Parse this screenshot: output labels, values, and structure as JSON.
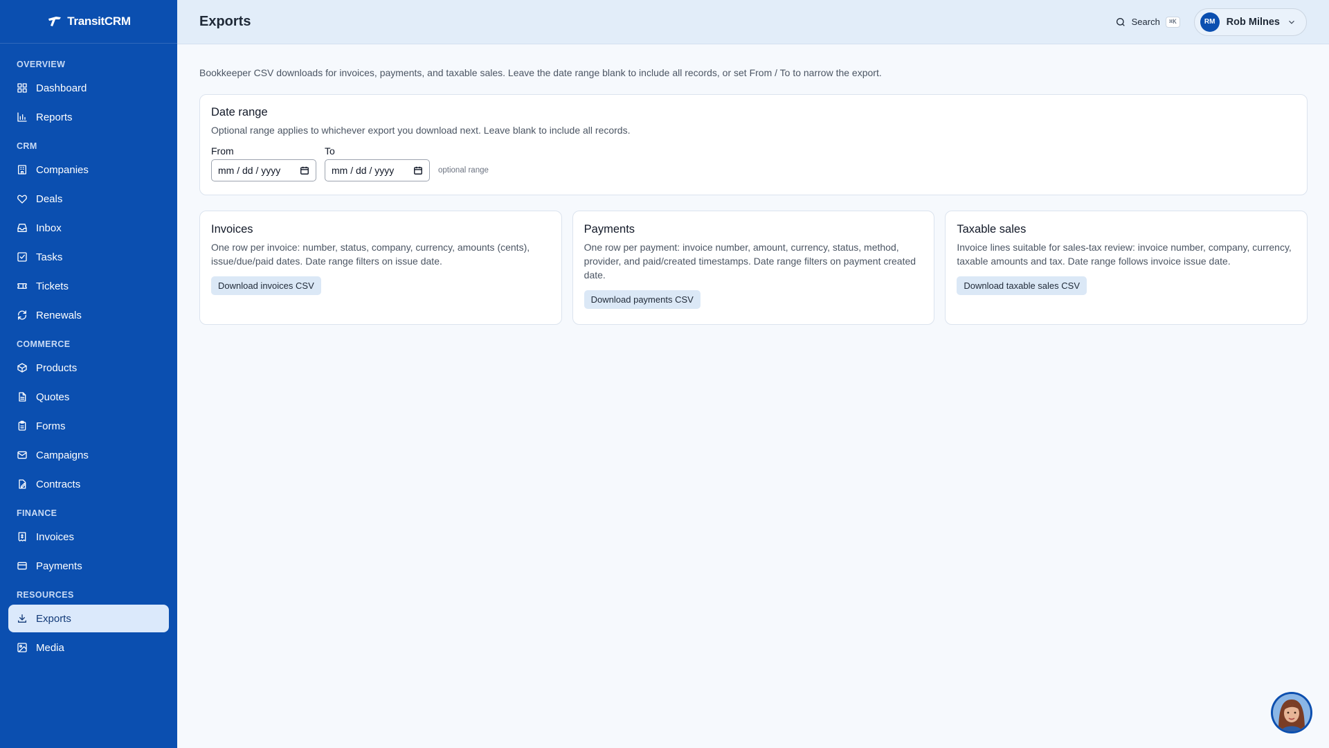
{
  "brand": {
    "name": "TransitCRM"
  },
  "sidebar": {
    "sections": [
      {
        "label": "OVERVIEW",
        "items": [
          {
            "label": "Dashboard",
            "icon": "dashboard-icon"
          },
          {
            "label": "Reports",
            "icon": "bar-chart-icon"
          }
        ]
      },
      {
        "label": "CRM",
        "items": [
          {
            "label": "Companies",
            "icon": "building-icon"
          },
          {
            "label": "Deals",
            "icon": "handshake-icon"
          },
          {
            "label": "Inbox",
            "icon": "inbox-icon"
          },
          {
            "label": "Tasks",
            "icon": "checkbox-icon"
          },
          {
            "label": "Tickets",
            "icon": "ticket-icon"
          },
          {
            "label": "Renewals",
            "icon": "refresh-icon"
          }
        ]
      },
      {
        "label": "COMMERCE",
        "items": [
          {
            "label": "Products",
            "icon": "box-icon"
          },
          {
            "label": "Quotes",
            "icon": "document-icon"
          },
          {
            "label": "Forms",
            "icon": "clipboard-icon"
          },
          {
            "label": "Campaigns",
            "icon": "mail-icon"
          },
          {
            "label": "Contracts",
            "icon": "contract-icon"
          }
        ]
      },
      {
        "label": "FINANCE",
        "items": [
          {
            "label": "Invoices",
            "icon": "receipt-icon"
          },
          {
            "label": "Payments",
            "icon": "credit-card-icon"
          }
        ]
      },
      {
        "label": "RESOURCES",
        "items": [
          {
            "label": "Exports",
            "icon": "download-icon",
            "active": true
          },
          {
            "label": "Media",
            "icon": "image-icon"
          }
        ]
      }
    ]
  },
  "header": {
    "title": "Exports",
    "search_label": "Search",
    "search_shortcut": "⌘K",
    "user": {
      "initials": "RM",
      "name": "Rob Milnes"
    }
  },
  "main": {
    "intro": "Bookkeeper CSV downloads for invoices, payments, and taxable sales. Leave the date range blank to include all records, or set From / To to narrow the export.",
    "date_range": {
      "title": "Date range",
      "description": "Optional range applies to whichever export you download next. Leave blank to include all records.",
      "from_label": "From",
      "to_label": "To",
      "from_placeholder": "mm / dd / yyyy",
      "to_placeholder": "mm / dd / yyyy",
      "hint": "optional range"
    },
    "exports": [
      {
        "title": "Invoices",
        "description": "One row per invoice: number, status, company, currency, amounts (cents), issue/due/paid dates. Date range filters on issue date.",
        "button": "Download invoices CSV"
      },
      {
        "title": "Payments",
        "description": "One row per payment: invoice number, amount, currency, status, method, provider, and paid/created timestamps. Date range filters on payment created date.",
        "button": "Download payments CSV"
      },
      {
        "title": "Taxable sales",
        "description": "Invoice lines suitable for sales-tax review: invoice number, company, currency, taxable amounts and tax. Date range follows invoice issue date.",
        "button": "Download taxable sales CSV"
      }
    ]
  },
  "colors": {
    "sidebar": "#0b4fb0",
    "header": "#e2edf9",
    "background": "#f6f9fd",
    "active_item": "#dbe9fb",
    "button": "#dbe8f6"
  }
}
